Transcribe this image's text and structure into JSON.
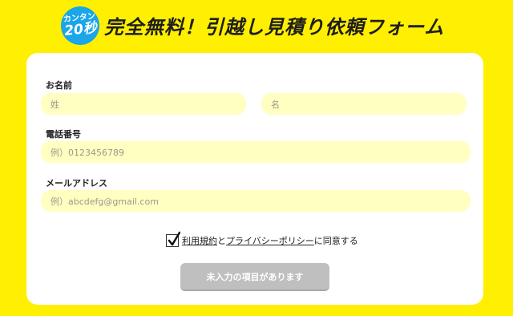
{
  "header": {
    "badge_small": "カンタン",
    "badge_big": "20秒",
    "title": "完全無料！引越し見積り依頼フォーム"
  },
  "form": {
    "name_label": "お名前",
    "last_name_placeholder": "姓",
    "first_name_placeholder": "名",
    "phone_label": "電話番号",
    "phone_placeholder": "例）0123456789",
    "email_label": "メールアドレス",
    "email_placeholder": "例）abcdefg@gmail.com",
    "consent": {
      "checked": true,
      "terms_link": "利用規約",
      "and": "と",
      "privacy_link": "プライバシーポリシー",
      "suffix": "に同意する"
    },
    "submit_label": "未入力の項目があります"
  }
}
